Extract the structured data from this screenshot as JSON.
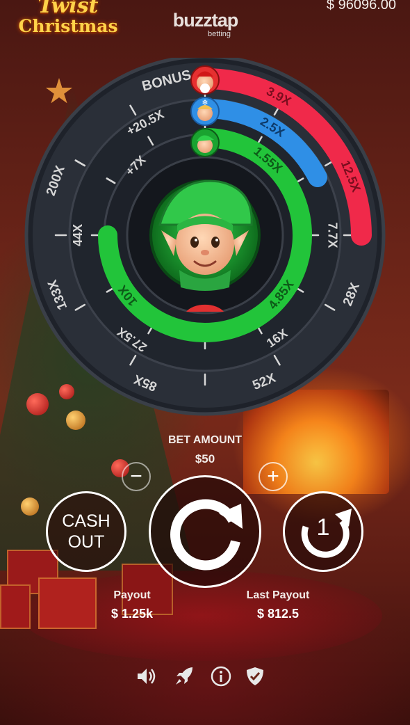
{
  "header": {
    "logo_line1": "Twist",
    "logo_line2": "Christmas",
    "brand_name": "buzztap",
    "brand_sub": "betting",
    "balance": "$ 96096.00"
  },
  "wheel": {
    "outer_ring": [
      "BONUS",
      "200X",
      "133X",
      "85X",
      "52X",
      "28X"
    ],
    "middle_ring": [
      "+20.5X",
      "44X",
      "27.5X",
      "16X",
      "7.7X"
    ],
    "inner_ring": [
      "+7X",
      "10X",
      "4.85X"
    ],
    "red_track": [
      "3.9X",
      "12.5X"
    ],
    "blue_track": [
      "2.5X"
    ],
    "green_track": [
      "1.55X"
    ],
    "markers": [
      "santa-icon",
      "snowgirl-icon",
      "elf-icon"
    ],
    "center_character": "elf-icon",
    "colors": {
      "red": "#f0294a",
      "blue": "#2f8fe6",
      "green": "#22c43a",
      "ring": "#252a33"
    }
  },
  "controls": {
    "bet_label": "BET AMOUNT",
    "bet_value": "$50",
    "minus_symbol": "−",
    "plus_symbol": "+",
    "cashout_line1": "CASH",
    "cashout_line2": "OUT",
    "autoplay_count": "1"
  },
  "stats": {
    "payout_label": "Payout",
    "payout_value": "$ 1.25k",
    "last_payout_label": "Last Payout",
    "last_payout_value": "$ 812.5"
  },
  "footer": {
    "icons": [
      "sound-icon",
      "rocket-icon",
      "info-icon",
      "shield-icon"
    ]
  }
}
